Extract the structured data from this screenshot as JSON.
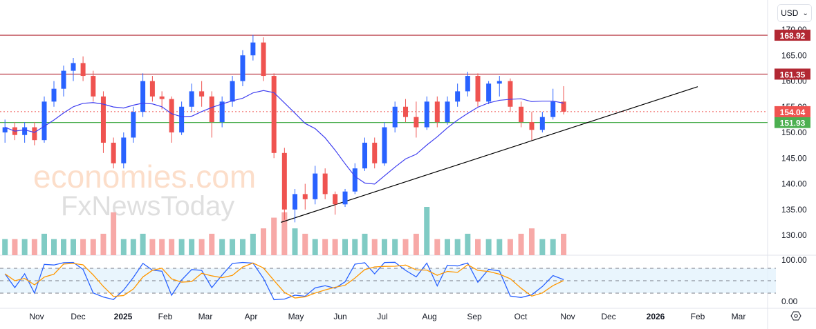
{
  "currency_button": {
    "label": "USD",
    "icon": "chevron-down-icon"
  },
  "watermark": {
    "line1": "economies.com",
    "line2": "FxNewsToday"
  },
  "settings_icon": "gear-icon",
  "chart_data": {
    "type": "candlestick",
    "price_axis": {
      "min": 130,
      "max": 170,
      "ticks": [
        "170.00",
        "165.00",
        "160.00",
        "155.00",
        "150.00",
        "145.00",
        "140.00",
        "135.00",
        "130.00"
      ]
    },
    "time_axis": {
      "labels": [
        "Nov",
        "Dec",
        "2025",
        "Feb",
        "Mar",
        "Apr",
        "May",
        "Jun",
        "Jul",
        "Aug",
        "Sep",
        "Oct",
        "Nov",
        "Dec",
        "2026",
        "Feb",
        "Mar"
      ]
    },
    "colors": {
      "up": "#2962ff",
      "down": "#ef5350",
      "ma": "#3f3ff0",
      "vol_up": "#80cbc4",
      "vol_down": "#f7a9a7",
      "stoch_k": "#2962ff",
      "stoch_d": "#ff9800",
      "trendline": "#000000"
    },
    "horizontal_lines": [
      {
        "price": 168.92,
        "label": "168.92",
        "color": "#b22833"
      },
      {
        "price": 161.35,
        "label": "161.35",
        "color": "#b22833"
      },
      {
        "price": 151.93,
        "label": "151.93",
        "color": "#4caf50"
      }
    ],
    "last_price": {
      "price": 154.04,
      "label": "154.04",
      "color": "#ef5350"
    },
    "trendline": [
      {
        "date": "2025-04-21",
        "price": 132.5
      },
      {
        "date": "2026-02-01",
        "price": 158.9
      }
    ],
    "candles": [
      [
        "2024-10-07",
        150,
        152.5,
        148,
        151
      ],
      [
        "2024-10-14",
        151,
        152,
        148.5,
        149.5
      ],
      [
        "2024-10-21",
        149.5,
        152,
        148,
        151
      ],
      [
        "2024-10-28",
        151,
        152,
        147.5,
        148.5
      ],
      [
        "2024-11-04",
        148.5,
        157,
        148,
        156
      ],
      [
        "2024-11-11",
        156,
        160,
        155,
        158.5
      ],
      [
        "2024-11-18",
        158.5,
        163,
        157,
        162
      ],
      [
        "2024-11-25",
        162,
        164.5,
        160,
        163.5
      ],
      [
        "2024-12-02",
        163.5,
        164.8,
        160,
        161
      ],
      [
        "2024-12-09",
        161,
        162,
        156,
        157
      ],
      [
        "2024-12-16",
        157,
        158,
        146,
        148
      ],
      [
        "2024-12-23",
        148,
        149,
        143,
        144
      ],
      [
        "2024-12-30",
        144,
        150,
        143,
        149
      ],
      [
        "2025-01-06",
        149,
        155,
        148,
        154
      ],
      [
        "2025-01-13",
        154,
        161.5,
        153,
        160
      ],
      [
        "2025-01-20",
        160,
        161,
        156,
        157
      ],
      [
        "2025-01-27",
        157,
        158,
        154.5,
        156.5
      ],
      [
        "2025-02-03",
        156.5,
        157,
        148,
        150
      ],
      [
        "2025-02-10",
        150,
        156,
        149.5,
        155
      ],
      [
        "2025-02-17",
        155,
        159.5,
        154,
        158
      ],
      [
        "2025-02-24",
        158,
        160,
        155,
        157
      ],
      [
        "2025-03-03",
        157,
        158,
        149,
        152
      ],
      [
        "2025-03-10",
        152,
        157,
        151,
        156
      ],
      [
        "2025-03-17",
        156,
        161,
        155,
        160
      ],
      [
        "2025-03-24",
        160,
        166,
        159,
        165
      ],
      [
        "2025-03-31",
        165,
        169,
        164,
        167.5
      ],
      [
        "2025-04-07",
        167.5,
        168.5,
        160,
        161
      ],
      [
        "2025-04-14",
        161,
        161.5,
        145,
        146
      ],
      [
        "2025-04-21",
        146,
        147,
        133,
        135
      ],
      [
        "2025-04-28",
        135,
        139,
        132.5,
        138
      ],
      [
        "2025-05-05",
        138,
        140,
        135,
        137
      ],
      [
        "2025-05-12",
        137,
        143.5,
        136,
        142
      ],
      [
        "2025-05-19",
        142,
        143,
        137,
        138
      ],
      [
        "2025-05-26",
        138,
        138.5,
        134,
        136
      ],
      [
        "2025-06-02",
        136,
        139,
        135.5,
        138.5
      ],
      [
        "2025-06-09",
        138.5,
        144,
        138,
        143
      ],
      [
        "2025-06-16",
        143,
        149,
        142.5,
        148
      ],
      [
        "2025-06-23",
        148,
        149,
        143,
        144
      ],
      [
        "2025-06-30",
        144,
        152,
        143.5,
        151
      ],
      [
        "2025-07-07",
        151,
        156,
        150,
        155
      ],
      [
        "2025-07-14",
        155,
        156.5,
        152,
        153
      ],
      [
        "2025-07-21",
        153,
        156,
        149,
        151
      ],
      [
        "2025-07-28",
        151,
        157,
        150.5,
        156
      ],
      [
        "2025-08-04",
        156,
        157,
        151,
        152
      ],
      [
        "2025-08-11",
        152,
        157,
        151.5,
        156
      ],
      [
        "2025-08-18",
        156,
        159.5,
        155,
        158
      ],
      [
        "2025-08-25",
        158,
        161.8,
        157,
        161
      ],
      [
        "2025-09-01",
        161,
        161.5,
        155,
        156
      ],
      [
        "2025-09-08",
        156,
        160,
        155.5,
        159.5
      ],
      [
        "2025-09-15",
        159.5,
        161,
        157,
        160
      ],
      [
        "2025-09-22",
        160,
        160.5,
        154,
        155
      ],
      [
        "2025-09-29",
        155,
        156,
        151,
        152
      ],
      [
        "2025-10-06",
        152,
        154,
        148.5,
        150.5
      ],
      [
        "2025-10-13",
        150.5,
        154,
        150,
        153
      ],
      [
        "2025-10-20",
        153,
        158.5,
        152.5,
        156
      ],
      [
        "2025-10-27",
        156,
        159,
        153.5,
        154.04
      ]
    ],
    "volume": [
      3,
      3,
      3,
      3,
      4,
      3,
      3,
      3,
      3,
      3,
      4,
      8,
      3,
      3,
      4,
      3,
      3,
      3,
      3,
      3,
      3,
      4,
      3,
      3,
      3,
      4,
      5,
      7,
      8,
      5,
      4,
      3,
      3,
      3,
      3,
      3,
      4,
      3,
      3,
      3,
      3,
      4,
      9,
      3,
      3,
      3,
      4,
      3,
      3,
      3,
      3,
      4,
      5,
      3,
      3,
      4
    ],
    "indicator": {
      "name": "stochastic",
      "axis_ticks": [
        "100.00",
        "0.00"
      ],
      "levels": [
        80,
        50,
        20
      ]
    }
  }
}
